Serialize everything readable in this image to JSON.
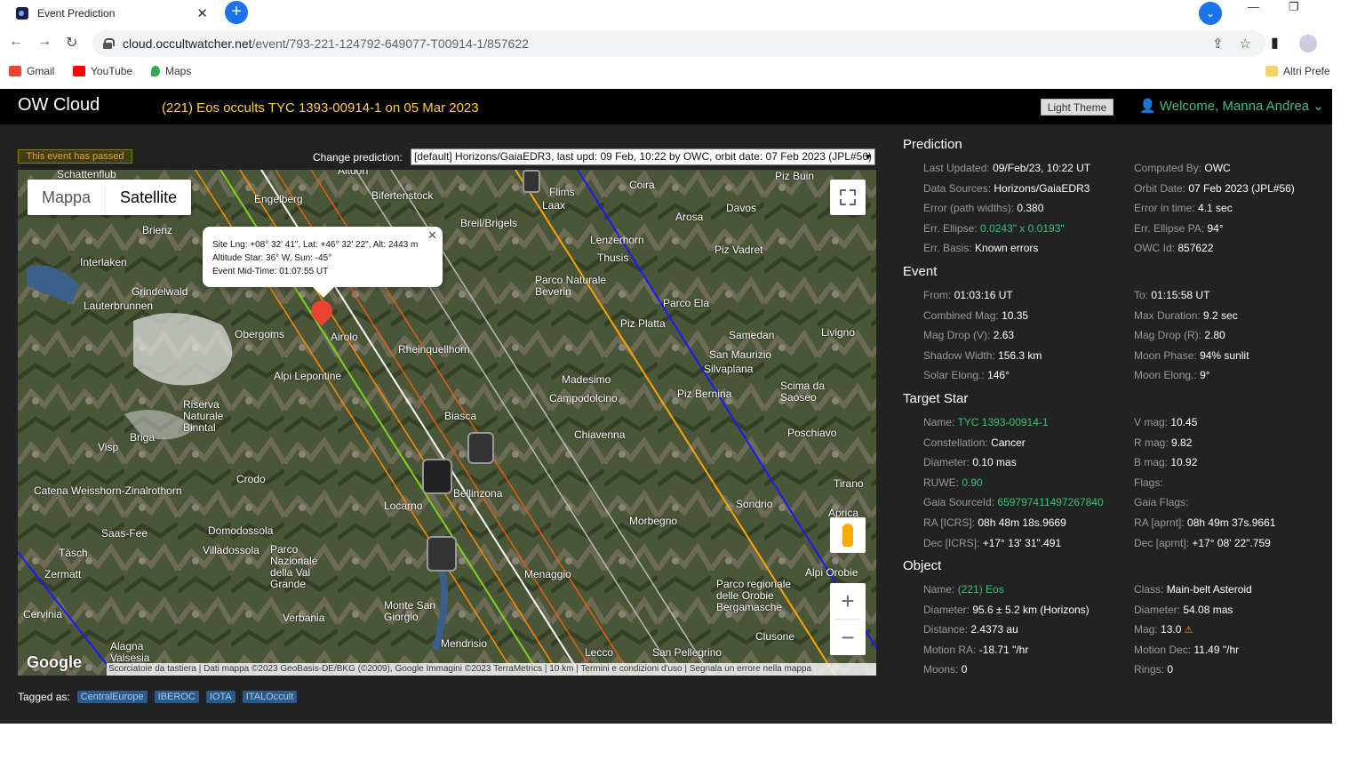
{
  "browser": {
    "tab_title": "Event Prediction",
    "url_host": "cloud.occultwatcher.net",
    "url_path": "/event/793-221-124792-649077-T00914-1/857622",
    "bookmarks": [
      "Gmail",
      "YouTube",
      "Maps"
    ],
    "other_bookmarks": "Altri Prefe"
  },
  "header": {
    "brand": "OW Cloud",
    "title": "(221) Eos occults TYC 1393-00914-1 on 05 Mar 2023",
    "theme_button": "Light Theme",
    "welcome": "Welcome, Manna Andrea"
  },
  "event_status": "This event has passed",
  "change_prediction": {
    "label": "Change prediction:",
    "selected": "[default] Horizons/GaiaEDR3, last upd: 09 Feb, 10:22 by OWC, orbit date: 07 Feb 2023 (JPL#56)"
  },
  "map": {
    "type_options": [
      "Mappa",
      "Satellite"
    ],
    "active_type": "Satellite",
    "info": {
      "line1": "Site Lng: +08° 32' 41\", Lat: +46° 32' 22\", Alt: 2443 m",
      "line2": "Altitude Star: 36° W, Sun: -45°",
      "line3": "Event Mid-Time: 01:07:55 UT"
    },
    "places": [
      "Schattenflub",
      "Altdorf",
      "Bifertenstock",
      "Flims",
      "Coira",
      "Piz Buin",
      "Engelberg",
      "Laax",
      "Davos",
      "Brienz",
      "Breil/Brigels",
      "Arosa",
      "Interlaken",
      "Lenzerhorn",
      "Thusis",
      "Piz Vadret",
      "Grindelwald",
      "Parco Naturale Beverin",
      "Lauterbrunnen",
      "Piz Platta",
      "Parco Ela",
      "Airolo",
      "Obergoms",
      "Rheinquellhorn",
      "Samedan",
      "Livigno",
      "Alpi Lepontine",
      "Piz Bernina",
      "Madesimo",
      "San Maurizio",
      "Silvaplana",
      "Scima da Saoseo",
      "Campodolcino",
      "Biasca",
      "Riserva Naturale Binntal",
      "Chiavenna",
      "Poschiavo",
      "Briga",
      "Visp",
      "Bellinzona",
      "Crodo",
      "Catena Weisshorn-Zinalrothorn",
      "Locarno",
      "Sondrio",
      "Tirano",
      "Aprica",
      "Saas-Fee",
      "Domodossola",
      "Morbegno",
      "Täsch",
      "Villadossola",
      "Parco Nazionale della Val Grande",
      "Menaggio",
      "Zermatt",
      "Alpi Orobie",
      "Parco regionale delle Orobie Bergamasche",
      "Cervinia",
      "Verbania",
      "Monte San Giorgio",
      "Mendrisio",
      "Clusone",
      "Lecco",
      "San Pellegrino",
      "Alagna Valsesia"
    ],
    "attribution": "Scorciatoie da tastiera | Dati mappa ©2023 GeoBasis-DE/BKG (©2009), Google Immagini ©2023 TerraMetrics | 10 km | Termini e condizioni d'uso | Segnala un errore nella mappa",
    "logo": "Google"
  },
  "tags": {
    "label": "Tagged as:",
    "items": [
      "CentralEurope",
      "IBEROC",
      "IOTA",
      "ITALOccult"
    ]
  },
  "prediction": {
    "title": "Prediction",
    "rows": [
      [
        {
          "k": "Last Updated:",
          "v": "09/Feb/23, 10:22 UT"
        },
        {
          "k": "Computed By:",
          "v": "OWC"
        }
      ],
      [
        {
          "k": "Data Sources:",
          "v": "Horizons/GaiaEDR3"
        },
        {
          "k": "Orbit Date:",
          "v": "07 Feb 2023 (JPL#56)"
        }
      ],
      [
        {
          "k": "Error (path widths):",
          "v": "0.380"
        },
        {
          "k": "Error in time:",
          "v": "4.1 sec"
        }
      ],
      [
        {
          "k": "Err. Ellipse:",
          "v": "0.0243\" x 0.0193\""
        },
        {
          "k": "Err. Ellipse PA:",
          "v": "94°"
        }
      ],
      [
        {
          "k": "Err. Basis:",
          "v": "Known errors"
        },
        {
          "k": "OWC Id:",
          "v": "857622"
        }
      ]
    ]
  },
  "event": {
    "title": "Event",
    "rows": [
      [
        {
          "k": "From:",
          "v": "01:03:16 UT"
        },
        {
          "k": "To:",
          "v": "01:15:58 UT"
        }
      ],
      [
        {
          "k": "Combined Mag:",
          "v": "10.35"
        },
        {
          "k": "Max Duration:",
          "v": "9.2 sec"
        }
      ],
      [
        {
          "k": "Mag Drop (V):",
          "v": "2.63"
        },
        {
          "k": "Mag Drop (R):",
          "v": "2.80"
        }
      ],
      [
        {
          "k": "Shadow Width:",
          "v": "156.3 km"
        },
        {
          "k": "Moon Phase:",
          "v": "94% sunlit"
        }
      ],
      [
        {
          "k": "Solar Elong.:",
          "v": "146°"
        },
        {
          "k": "Moon Elong.:",
          "v": "9°"
        }
      ]
    ]
  },
  "target_star": {
    "title": "Target Star",
    "rows": [
      [
        {
          "k": "Name:",
          "v": "TYC 1393-00914-1"
        },
        {
          "k": "V mag:",
          "v": "10.45"
        }
      ],
      [
        {
          "k": "Constellation:",
          "v": "Cancer"
        },
        {
          "k": "R mag:",
          "v": "9.82"
        }
      ],
      [
        {
          "k": "Diameter:",
          "v": "0.10 mas"
        },
        {
          "k": "B mag:",
          "v": "10.92"
        }
      ],
      [
        {
          "k": "RUWE:",
          "v": "0.90"
        },
        {
          "k": "Flags:",
          "v": ""
        }
      ],
      [
        {
          "k": "Gaia SourceId:",
          "v": "659797411497267840"
        },
        {
          "k": "Gaia Flags:",
          "v": ""
        }
      ],
      [
        {
          "k": "RA [ICRS]:",
          "v": "08h 48m 18s.9669"
        },
        {
          "k": "RA [aprnt]:",
          "v": "08h 49m 37s.9661"
        }
      ],
      [
        {
          "k": "Dec [ICRS]:",
          "v": "+17° 13' 31\".491"
        },
        {
          "k": "Dec [aprnt]:",
          "v": "+17° 08' 22\".759"
        }
      ]
    ]
  },
  "object": {
    "title": "Object",
    "rows": [
      [
        {
          "k": "Name:",
          "v": "(221) Eos"
        },
        {
          "k": "Class:",
          "v": "Main-belt Asteroid"
        }
      ],
      [
        {
          "k": "Diameter:",
          "v": "95.6 ± 5.2 km  (Horizons)"
        },
        {
          "k": "Diameter:",
          "v": "54.08 mas"
        }
      ],
      [
        {
          "k": "Distance:",
          "v": "2.4373 au"
        },
        {
          "k": "Mag:",
          "v": "13.0"
        }
      ],
      [
        {
          "k": "Motion RA:",
          "v": "-18.71 \"/hr"
        },
        {
          "k": "Motion Dec:",
          "v": "11.49 \"/hr"
        }
      ],
      [
        {
          "k": "Moons:",
          "v": "0"
        },
        {
          "k": "Rings:",
          "v": "0"
        }
      ]
    ]
  }
}
